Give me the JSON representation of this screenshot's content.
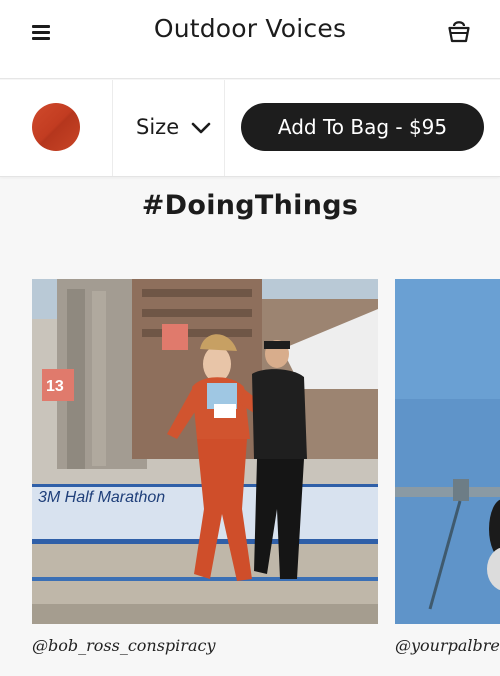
{
  "header": {
    "brand": "Outdoor Voices",
    "menu_icon": "hamburger-menu-icon",
    "bag_icon": "shopping-bag-icon"
  },
  "product_bar": {
    "selected_color": "#c8432a",
    "size_label": "Size",
    "add_to_bag_label": "Add To Bag - $95"
  },
  "section": {
    "title": "#DoingThings"
  },
  "gallery": [
    {
      "caption": "@bob_ross_conspiracy",
      "banner_text": "3M Half Marathon",
      "mile_marker": "13"
    },
    {
      "caption": "@yourpalbreez"
    }
  ]
}
